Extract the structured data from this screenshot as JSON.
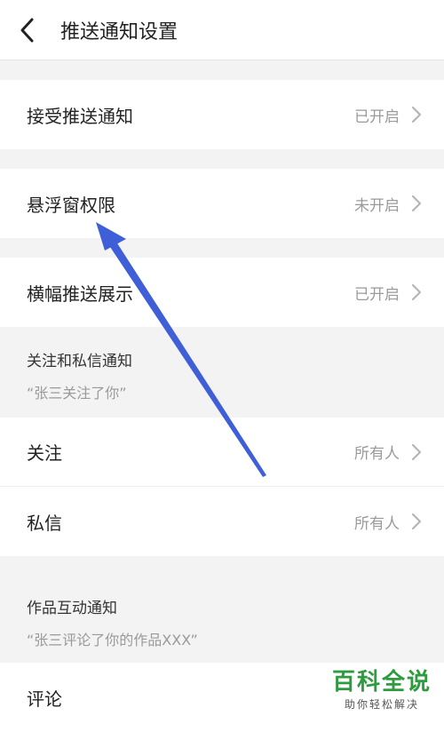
{
  "header": {
    "title": "推送通知设置",
    "back_icon": "chevron-left-icon"
  },
  "rows_top": [
    {
      "label": "接受推送通知",
      "value": "已开启"
    },
    {
      "label": "悬浮窗权限",
      "value": "未开启"
    },
    {
      "label": "横幅推送展示",
      "value": "已开启"
    }
  ],
  "section_follow": {
    "title": "关注和私信通知",
    "subtitle": "“张三关注了你”"
  },
  "rows_follow": [
    {
      "label": "关注",
      "value": "所有人"
    },
    {
      "label": "私信",
      "value": "所有人"
    }
  ],
  "section_works": {
    "title": "作品互动通知",
    "subtitle": "“张三评论了你的作品XXX”"
  },
  "rows_works": [
    {
      "label": "评论"
    }
  ],
  "watermark": {
    "main": "百科全说",
    "sub": "助你轻松解决"
  },
  "colors": {
    "arrow": "#3f5fd8",
    "watermark": "#2e9b3f"
  }
}
